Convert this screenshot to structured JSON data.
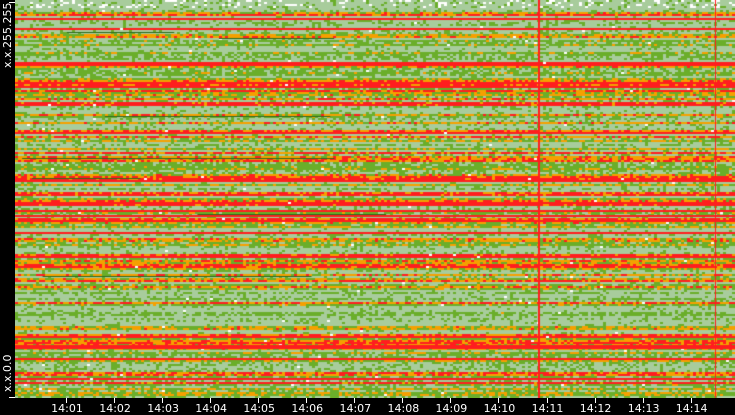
{
  "chart_data": {
    "type": "heatmap",
    "title": "",
    "xlabel": "",
    "ylabel": "",
    "x_ticks": [
      "14:01",
      "14:02",
      "14:03",
      "14:04",
      "14:05",
      "14:06",
      "14:07",
      "14:08",
      "14:09",
      "14:10",
      "14:11",
      "14:12",
      "14:13",
      "14:14"
    ],
    "y_ticks": [
      "x.x.255.255",
      "x.x.0.0"
    ],
    "color_scale": {
      "low": "#a8cc9c",
      "mid_low": "#6aae2a",
      "mid_high": "#f5a000",
      "high": "#ff1e1e",
      "outlier": "#2d6a1e",
      "empty": "#ffffff"
    },
    "grid": false,
    "legend": "none"
  }
}
